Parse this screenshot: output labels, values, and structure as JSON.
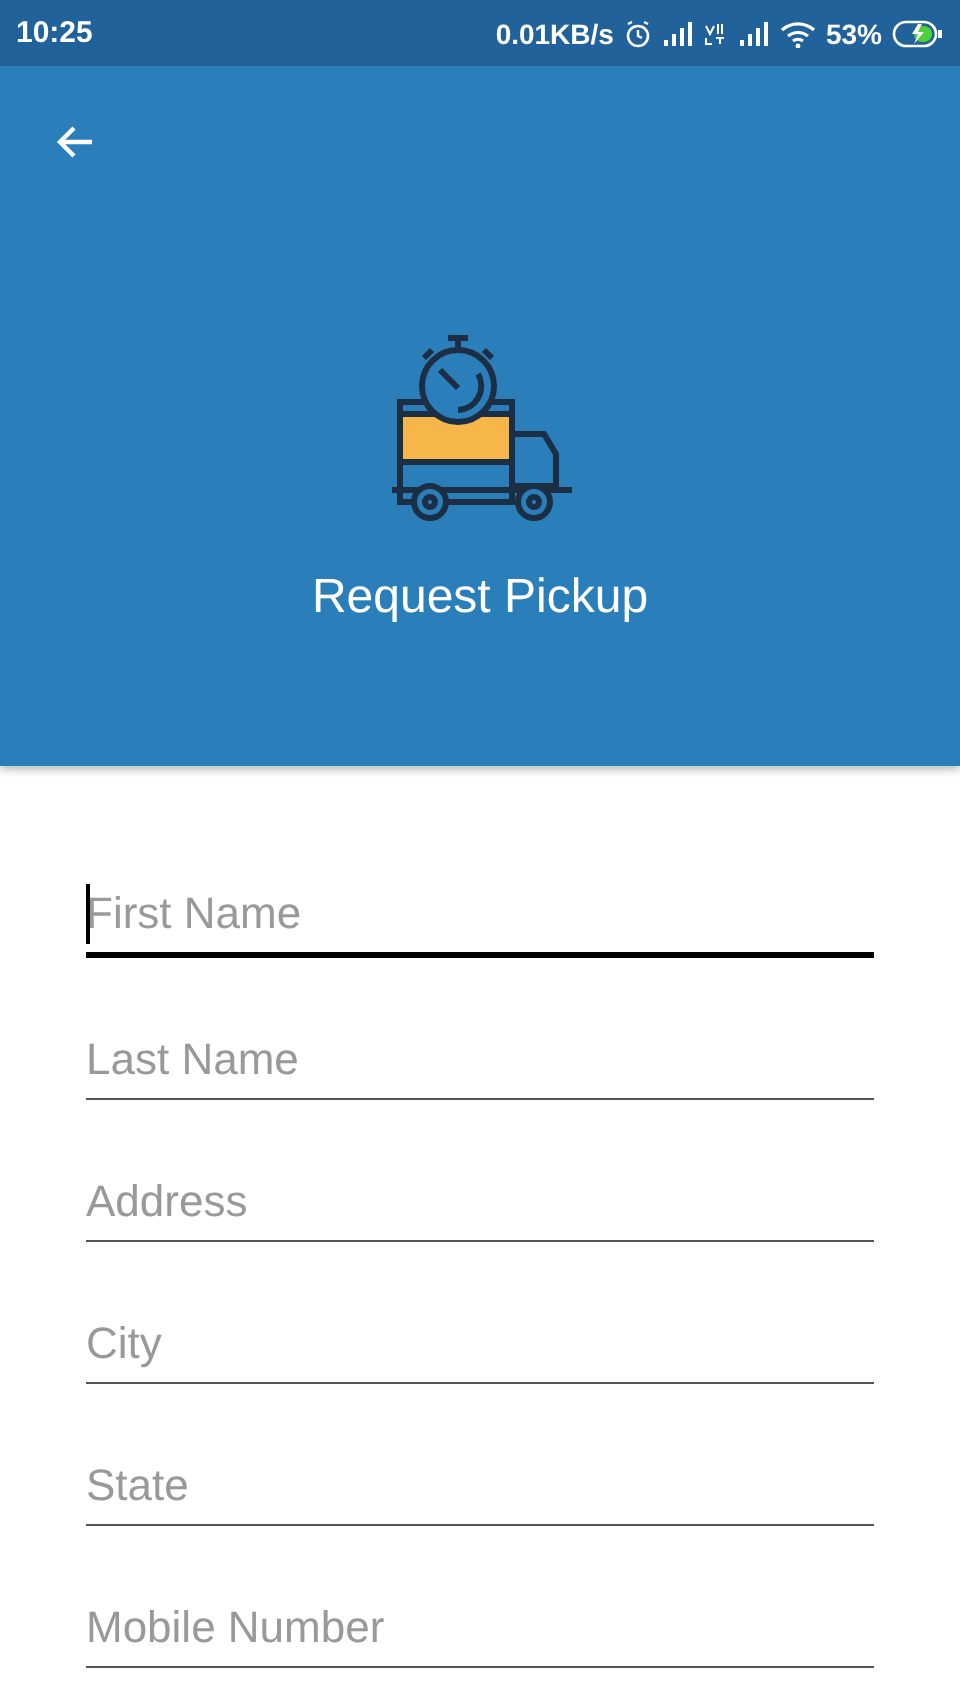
{
  "status_bar": {
    "time": "10:25",
    "speed": "0.01KB/s",
    "battery": "53%"
  },
  "header": {
    "title": "Request Pickup"
  },
  "fields": [
    {
      "placeholder": "First Name",
      "focused": true
    },
    {
      "placeholder": "Last Name",
      "focused": false
    },
    {
      "placeholder": "Address",
      "focused": false
    },
    {
      "placeholder": "City",
      "focused": false
    },
    {
      "placeholder": "State",
      "focused": false
    },
    {
      "placeholder": "Mobile Number",
      "focused": false
    }
  ]
}
